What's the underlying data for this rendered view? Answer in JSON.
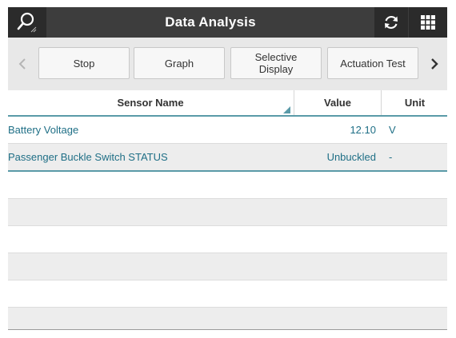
{
  "header": {
    "title": "Data Analysis"
  },
  "toolbar": {
    "buttons": [
      {
        "label": "Stop"
      },
      {
        "label": "Graph"
      },
      {
        "label": "Selective\nDisplay"
      },
      {
        "label": "Actuation Test"
      }
    ],
    "prev_icon": "chevron-left-icon",
    "next_icon": "chevron-right-icon"
  },
  "table": {
    "columns": {
      "name": "Sensor Name",
      "value": "Value",
      "unit": "Unit"
    },
    "rows": [
      {
        "name": "Battery Voltage",
        "value": "12.10",
        "unit": "V"
      },
      {
        "name": "Passenger Buckle Switch STATUS",
        "value": "Unbuckled",
        "unit": "-"
      }
    ]
  },
  "colors": {
    "titlebar": "#3d3d3d",
    "accent": "#5a9aa8",
    "row_text": "#1f6f86"
  },
  "icons": [
    "search-icon",
    "refresh-icon",
    "grid-menu-icon",
    "chevron-left-icon",
    "chevron-right-icon",
    "sort-indicator-icon"
  ]
}
